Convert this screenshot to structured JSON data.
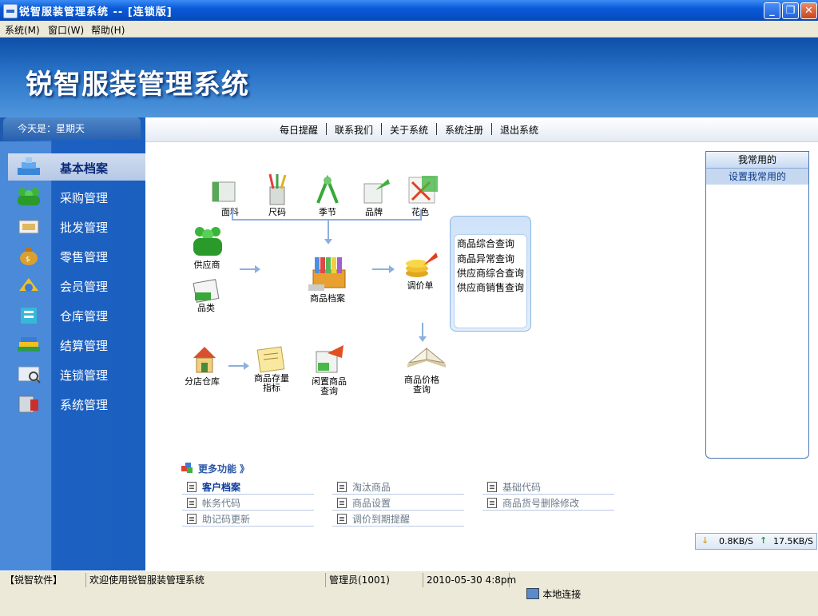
{
  "window": {
    "title": "锐智服装管理系统 -- [连锁版]",
    "buttons": {
      "minimize": "_",
      "restore": "❐",
      "close": "✕"
    }
  },
  "menu": [
    "系统(M)",
    "窗口(W)",
    "帮助(H)"
  ],
  "banner": {
    "logo": "锐智服装管理系统"
  },
  "sidebar": {
    "today": "今天是：星期天",
    "items": [
      {
        "label": "基本档案",
        "icon": "building-blocks-icon",
        "active": true
      },
      {
        "label": "采购管理",
        "icon": "people-group-icon"
      },
      {
        "label": "批发管理",
        "icon": "boxes-icon"
      },
      {
        "label": "零售管理",
        "icon": "money-bag-icon"
      },
      {
        "label": "会员管理",
        "icon": "member-card-icon"
      },
      {
        "label": "仓库管理",
        "icon": "warehouse-icon"
      },
      {
        "label": "结算管理",
        "icon": "books-icon"
      },
      {
        "label": "连锁管理",
        "icon": "chain-store-icon"
      },
      {
        "label": "系统管理",
        "icon": "tools-icon"
      }
    ]
  },
  "toplinks": [
    "每日提醒",
    "联系我们",
    "关于系统",
    "系统注册",
    "退出系统"
  ],
  "flow": {
    "fabric": "面料",
    "size": "尺码",
    "season": "季节",
    "brand": "品牌",
    "color": "花色",
    "supplier": "供应商",
    "category": "品类",
    "product_archive": "商品档案",
    "price_adjust": "调价单",
    "branch_warehouse": "分店仓库",
    "stock_index_1": "商品存量",
    "stock_index_2": "指标",
    "idle_goods_1": "闲置商品",
    "idle_goods_2": "查询",
    "price_query_1": "商品价格",
    "price_query_2": "查询"
  },
  "queries": [
    "商品综合查询",
    "商品异常查询",
    "供应商综合查询",
    "供应商销售查询"
  ],
  "favorites": {
    "header": "我常用的",
    "set": "设置我常用的"
  },
  "more": {
    "title": "更多功能 》",
    "items": [
      {
        "label": "客户档案",
        "strong": true
      },
      {
        "label": "淘汰商品"
      },
      {
        "label": "基础代码"
      },
      {
        "label": "帐务代码"
      },
      {
        "label": "商品设置"
      },
      {
        "label": "商品货号删除修改"
      },
      {
        "label": "助记码更新"
      },
      {
        "label": "调价到期提醒"
      }
    ]
  },
  "net": {
    "down": "0.8KB/S",
    "up": "17.5KB/S"
  },
  "status": {
    "company": "【锐智软件】",
    "welcome": "欢迎使用锐智服装管理系统",
    "user": "管理员(1001)",
    "datetime": "2010-05-30 4:8pm",
    "connection": "本地连接"
  }
}
